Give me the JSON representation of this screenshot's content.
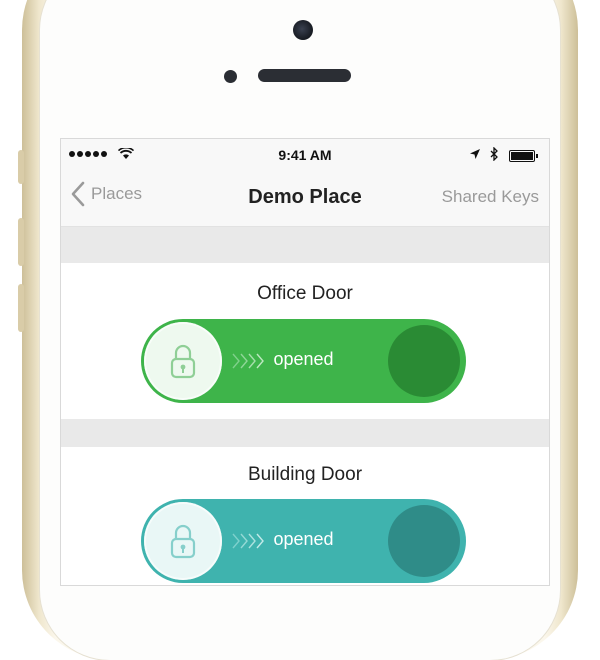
{
  "statusbar": {
    "time": "9:41 AM"
  },
  "navbar": {
    "back_label": "Places",
    "title": "Demo Place",
    "right_label": "Shared Keys"
  },
  "doors": [
    {
      "name": "Office Door",
      "status": "opened",
      "color": "#3eb44a"
    },
    {
      "name": "Building Door",
      "status": "opened",
      "color": "#3fb3ae"
    }
  ],
  "icons": {
    "wifi": "wifi-icon",
    "location": "location-arrow-icon",
    "bluetooth": "bluetooth-icon",
    "battery": "battery-icon",
    "lock": "padlock-icon"
  }
}
